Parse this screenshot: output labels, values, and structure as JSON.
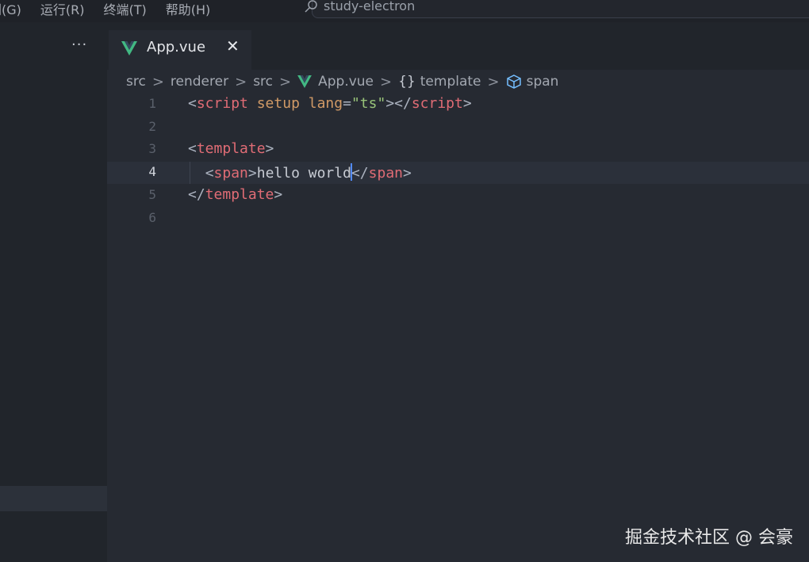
{
  "menu": {
    "items": [
      "刨(G)",
      "运行(R)",
      "终端(T)",
      "帮助(H)"
    ]
  },
  "search": {
    "text": "study-electron"
  },
  "sidebar": {
    "more_label": "···"
  },
  "tab": {
    "label": "App.vue",
    "close": "✕"
  },
  "breadcrumb": {
    "items": [
      "src",
      "renderer",
      "src",
      "App.vue",
      "template",
      "span"
    ],
    "separator": ">",
    "brace": "{}"
  },
  "code": {
    "line_numbers": [
      "1",
      "2",
      "3",
      "4",
      "5",
      "6"
    ],
    "current_line": "4",
    "l1": {
      "open": "<",
      "tag": "script",
      "attr1": "setup",
      "attr2": "lang",
      "eq": "=",
      "str": "\"ts\"",
      "close": "></",
      "tag2": "script",
      "end": ">"
    },
    "l3": {
      "open": "<",
      "tag": "template",
      "end": ">"
    },
    "l4": {
      "open": "<",
      "tag": "span",
      "end": ">",
      "text": "hello world",
      "close": "</",
      "tag2": "span",
      "end2": ">"
    },
    "l5": {
      "open": "</",
      "tag": "template",
      "end": ">"
    }
  },
  "watermark": "掘金技术社区 @ 会豪",
  "colors": {
    "tag": "#e06c75",
    "attr": "#d19a66",
    "string": "#98c379",
    "cursor": "#528bff",
    "vue_green": "#42b883"
  }
}
